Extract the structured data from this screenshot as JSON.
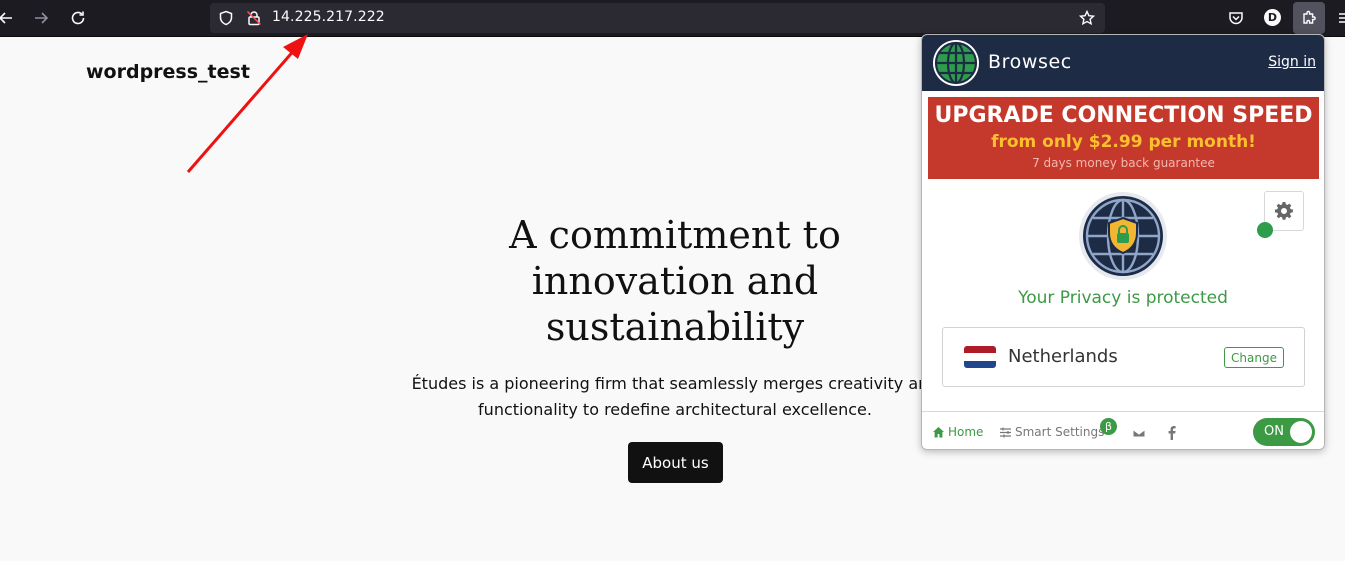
{
  "browser": {
    "url": "14.225.217.222",
    "profile_initial": "D",
    "icons": {
      "back": "back-arrow-icon",
      "forward": "forward-arrow-icon",
      "reload": "reload-icon",
      "shield": "tracking-protection-icon",
      "insecure_lock": "insecure-lock-icon",
      "bookmark": "star-icon",
      "pocket": "pocket-icon",
      "extensions": "extensions-icon",
      "menu": "hamburger-menu-icon"
    }
  },
  "page": {
    "site_title": "wordpress_test",
    "hero_heading": "A commitment to innovation and sustainability",
    "hero_text": "Études is a pioneering firm that seamlessly merges creativity and functionality to redefine architectural excellence.",
    "cta_label": "About us"
  },
  "annotation": {
    "type": "red-arrow",
    "color": "#ee1111"
  },
  "extension_popup": {
    "brand": "Browsec",
    "sign_in": "Sign in",
    "promo": {
      "title": "UPGRADE CONNECTION SPEED",
      "subtitle": "from only $2.99 per month!",
      "small": "7 days money back guarantee"
    },
    "status_text": "Your Privacy is protected",
    "country": "Netherlands",
    "change_label": "Change",
    "footer": {
      "home": "Home",
      "smart_settings": "Smart Settings",
      "beta_badge": "β",
      "toggle_label": "ON"
    },
    "colors": {
      "header_bg": "#1e2b45",
      "promo_bg": "#c4392b",
      "promo_accent": "#fbc02d",
      "green": "#3c9a45"
    }
  }
}
